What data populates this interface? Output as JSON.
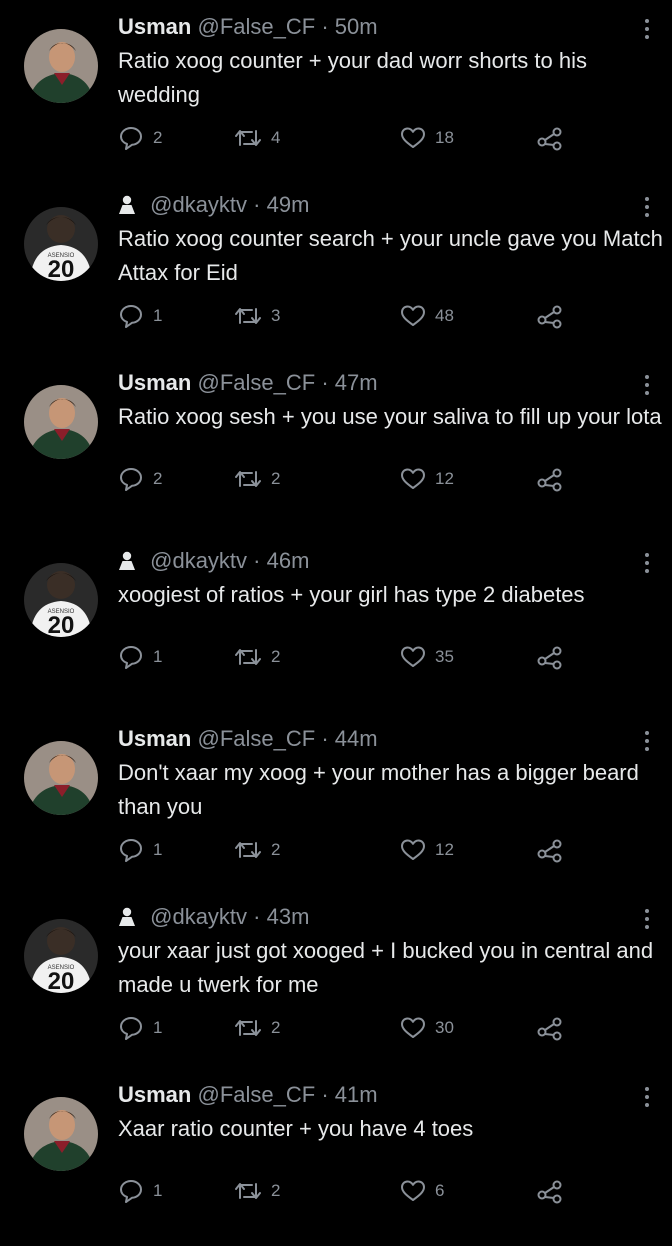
{
  "feed": {
    "tweets": [
      {
        "name": "Usman",
        "handle": "@False_CF",
        "time": "50m",
        "avatar": "player-photo",
        "text": "Ratio xoog counter + your dad worr shorts to his wedding",
        "replies": "2",
        "retweets": "4",
        "likes": "18"
      },
      {
        "name": "",
        "handle": "@dkayktv",
        "time": "49m",
        "avatar": "jersey-20",
        "text": "Ratio xoog counter search + your uncle gave you Match Attax for Eid",
        "replies": "1",
        "retweets": "3",
        "likes": "48"
      },
      {
        "name": "Usman",
        "handle": "@False_CF",
        "time": "47m",
        "avatar": "player-photo",
        "text": "Ratio xoog sesh + you use your saliva to fill up your lota",
        "replies": "2",
        "retweets": "2",
        "likes": "12"
      },
      {
        "name": "",
        "handle": "@dkayktv",
        "time": "46m",
        "avatar": "jersey-20",
        "text": "xoogiest of ratios + your girl has type 2 diabetes",
        "replies": "1",
        "retweets": "2",
        "likes": "35"
      },
      {
        "name": "Usman",
        "handle": "@False_CF",
        "time": "44m",
        "avatar": "player-photo",
        "text": "Don't xaar my xoog + your mother has a bigger beard than you",
        "replies": "1",
        "retweets": "2",
        "likes": "12"
      },
      {
        "name": "",
        "handle": "@dkayktv",
        "time": "43m",
        "avatar": "jersey-20",
        "text": "your xaar just got xooged + I bucked you in central and made u twerk for me",
        "replies": "1",
        "retweets": "2",
        "likes": "30"
      },
      {
        "name": "Usman",
        "handle": "@False_CF",
        "time": "41m",
        "avatar": "player-photo",
        "text": "Xaar ratio counter + you have 4 toes",
        "replies": "1",
        "retweets": "2",
        "likes": "6"
      }
    ]
  },
  "icons": {
    "reply": "reply-icon",
    "retweet": "retweet-icon",
    "like": "heart-icon",
    "share": "share-icon",
    "more": "more-vertical-icon",
    "person": "person-icon"
  },
  "colors": {
    "background": "#000000",
    "primary_text": "#e7e9ea",
    "secondary_text": "#8b9199"
  }
}
